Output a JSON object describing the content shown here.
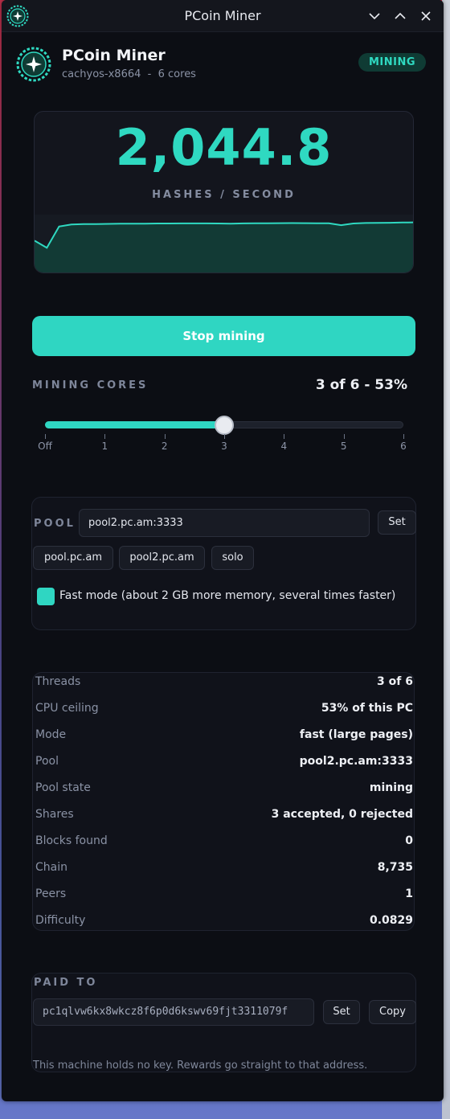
{
  "window": {
    "title": "PCoin Miner"
  },
  "header": {
    "app_name": "PCoin Miner",
    "host": "cachyos-x8664",
    "separator": "-",
    "cores_text": "6 cores",
    "status_badge": "MINING"
  },
  "hashrate": {
    "value": "2,044.8",
    "unit": "HASHES / SECOND",
    "sparkline": [
      1320,
      1040,
      1880,
      1960,
      1975,
      1980,
      1985,
      1990,
      1992,
      1995,
      2000,
      2002,
      2003,
      2004,
      2005,
      2002,
      1995,
      2005,
      2008,
      2010,
      2012,
      2015,
      2012,
      2008,
      2010,
      1935,
      2000,
      2020,
      2025,
      2030,
      2040,
      2044.8
    ],
    "spark_max": 2350
  },
  "controls": {
    "stop_label": "Stop mining"
  },
  "cores": {
    "label": "MINING CORES",
    "value_text": "3 of 6  -  53%",
    "selected": 3,
    "max": 6,
    "tick_labels": [
      "Off",
      "1",
      "2",
      "3",
      "4",
      "5",
      "6"
    ]
  },
  "pool": {
    "label": "POOL",
    "input_value": "pool2.pc.am:3333",
    "set_label": "Set",
    "presets": [
      "pool.pc.am",
      "pool2.pc.am",
      "solo"
    ],
    "fast_mode_checked": true,
    "fast_mode_label": "Fast mode (about 2 GB more memory, several times faster)"
  },
  "stats": [
    {
      "key": "Threads",
      "value": "3 of 6"
    },
    {
      "key": "CPU ceiling",
      "value": "53% of this PC"
    },
    {
      "key": "Mode",
      "value": "fast  (large pages)"
    },
    {
      "key": "Pool",
      "value": "pool2.pc.am:3333"
    },
    {
      "key": "Pool state",
      "value": "mining"
    },
    {
      "key": "Shares",
      "value": "3 accepted, 0 rejected"
    },
    {
      "key": "Blocks found",
      "value": "0"
    },
    {
      "key": "Chain",
      "value": "8,735"
    },
    {
      "key": "Peers",
      "value": "1"
    },
    {
      "key": "Difficulty",
      "value": "0.0829"
    }
  ],
  "paid_to": {
    "label": "PAID TO",
    "address": "pc1qlvw6kx8wkcz8f6p0d6kswv69fjt3311079f",
    "set_label": "Set",
    "copy_label": "Copy",
    "note": "This machine holds no key. Rewards go straight to that address."
  },
  "colors": {
    "accent": "#2fd9c1",
    "button": "#2fd6c2",
    "badge_bg": "#0f3b34"
  }
}
